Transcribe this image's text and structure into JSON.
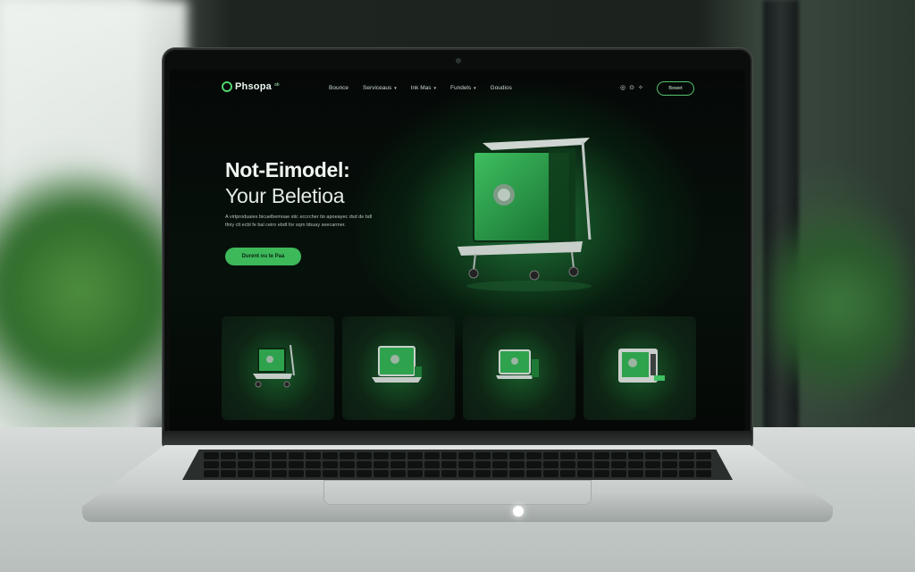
{
  "site": {
    "logo_text": "Phsopa",
    "logo_sup": "ab",
    "nav": {
      "items": [
        {
          "label": "Bounce",
          "dropdown": false
        },
        {
          "label": "Serviceaus",
          "dropdown": true
        },
        {
          "label": "Ink Mas",
          "dropdown": true
        },
        {
          "label": "Fundels",
          "dropdown": true
        },
        {
          "label": "Goudios",
          "dropdown": false
        }
      ],
      "icons": [
        "user-icon",
        "cart-icon",
        "settings-icon"
      ],
      "cta_label": "Bowet"
    },
    "hero": {
      "title_line1": "Not-Eimodel:",
      "title_line2": "Your Beletioa",
      "description": "A virtproduaies bicuelbemoae stic eccrcher tio apoeayec dsd de bdl tfoiy clt ecbl fe bal ceiro ebdt for sqrn bbuay seecarmer.",
      "cta_label": "Durent ou te Paa"
    },
    "cards": [
      {
        "icon": "shopping-cart-icon"
      },
      {
        "icon": "laptop-icon"
      },
      {
        "icon": "monitor-icon"
      },
      {
        "icon": "device-icon"
      }
    ]
  },
  "colors": {
    "accent": "#3db95a",
    "accent_outline": "#55c46c",
    "screen_bg": "#050807",
    "glow": "#28a046"
  }
}
